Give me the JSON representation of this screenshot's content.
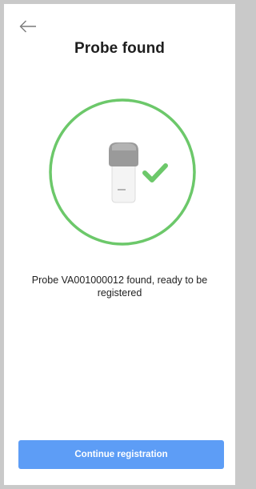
{
  "header": {
    "back_icon": "arrow-left-icon",
    "title": "Probe found"
  },
  "illustration": {
    "probe_icon": "ultrasound-probe-icon",
    "check_icon": "checkmark-icon",
    "ring_color": "#6cc86a",
    "check_color": "#6cc86a"
  },
  "message": {
    "text": "Probe VA001000012 found, ready to be registered"
  },
  "footer": {
    "continue_label": "Continue registration",
    "button_color": "#5d9df6"
  }
}
